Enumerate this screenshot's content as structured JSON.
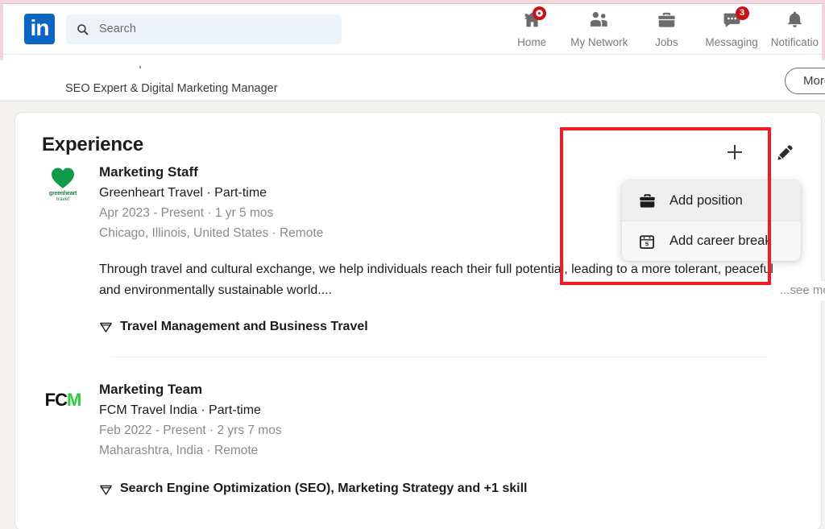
{
  "nav": {
    "logo_text": "in",
    "search": {
      "placeholder": "Search",
      "value": "",
      "icon": "search-icon"
    },
    "items": [
      {
        "label": "Home",
        "icon": "home-icon",
        "badge": "",
        "badge_type": "ring"
      },
      {
        "label": "My Network",
        "icon": "people-icon",
        "badge": "",
        "badge_type": "none"
      },
      {
        "label": "Jobs",
        "icon": "briefcase-icon",
        "badge": "",
        "badge_type": "none"
      },
      {
        "label": "Messaging",
        "icon": "message-icon",
        "badge": "3",
        "badge_type": "count"
      },
      {
        "label": "Notificatio",
        "icon": "bell-icon",
        "badge": "",
        "badge_type": "none"
      }
    ]
  },
  "profile_bar": {
    "headline": "SEO Expert & Digital Marketing Manager",
    "action_label": "More"
  },
  "experience": {
    "title": "Experience",
    "add_button_icon": "plus-icon",
    "edit_button_icon": "pencil-icon",
    "dropdown": {
      "items": [
        {
          "label": "Add position",
          "icon": "briefcase-icon",
          "hovered": true
        },
        {
          "label": "Add career break",
          "icon": "calendar-icon",
          "hovered": false
        }
      ]
    },
    "entries": [
      {
        "logo": "greenheart-travel-logo",
        "logo_text_line1": "greenheart",
        "logo_text_line2": "travel",
        "role": "Marketing Staff",
        "company": "Greenheart Travel · Part-time",
        "dates": "Apr 2023 - Present · 1 yr 5 mos",
        "location": "Chicago, Illinois, United States · Remote",
        "description": "Through travel and cultural exchange, we help individuals reach their full potential, leading to a more tolerant, peaceful and environmentally sustainable world....",
        "see_more_label": "...see more",
        "skills": "Travel Management and Business Travel",
        "skills_icon": "skill-gem-icon"
      },
      {
        "logo": "fcm-travel-logo",
        "logo_text_line1": "FCM",
        "logo_text_line2": "",
        "role": "Marketing Team",
        "company": "FCM Travel India · Part-time",
        "dates": "Feb 2022 - Present · 2 yrs 7 mos",
        "location": "Maharashtra, India · Remote",
        "description": "",
        "see_more_label": "",
        "skills": "Search Engine Optimization (SEO), Marketing Strategy and +1 skill",
        "skills_icon": "skill-gem-icon"
      }
    ]
  },
  "annotation": {
    "type": "highlight-box",
    "color": "#f01b24"
  },
  "colors": {
    "brand_blue": "#0a66c2",
    "page_background": "#f4f2ee",
    "card_background": "#ffffff",
    "badge_red": "#cc1016",
    "annotation_red": "#f01b24",
    "greenheart_green": "#1a7a3c",
    "fcm_green": "#2ccc3b"
  }
}
